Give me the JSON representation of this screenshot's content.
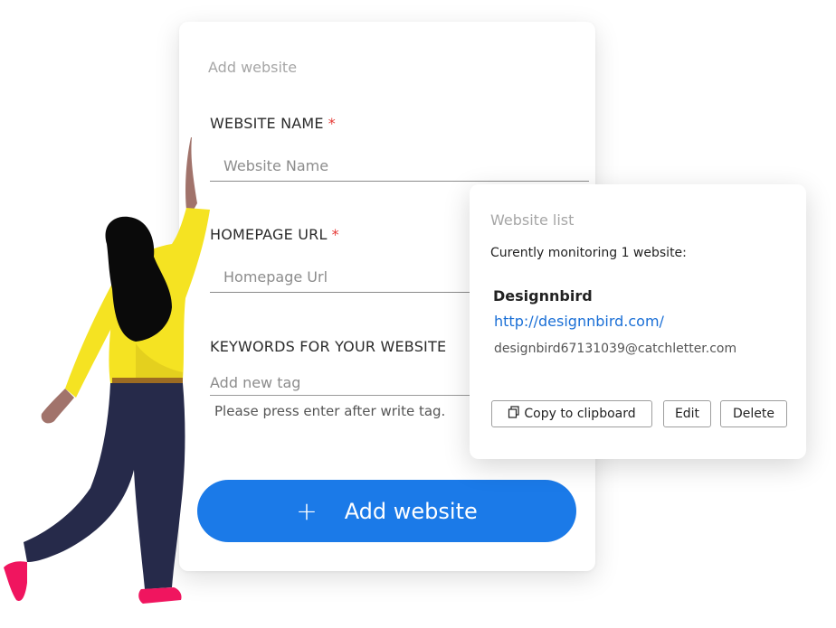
{
  "add_form": {
    "title": "Add website",
    "website_name": {
      "label": "WEBSITE NAME",
      "required_mark": "*",
      "placeholder": "Website Name"
    },
    "homepage_url": {
      "label": "HOMEPAGE URL",
      "required_mark": "*",
      "placeholder": "Homepage Url"
    },
    "keywords": {
      "label": "KEYWORDS FOR YOUR WEBSITE",
      "placeholder": "Add new tag",
      "hint": "Please press enter after write tag."
    },
    "submit": {
      "icon": "plus-icon",
      "label": "Add website"
    }
  },
  "website_list": {
    "title": "Website list",
    "status": "Curently monitoring 1 website:",
    "site": {
      "name": "Designnbird",
      "url": "http://designnbird.com/",
      "email": "designbird67131039@catchletter.com"
    },
    "actions": {
      "copy_icon": "copy-icon",
      "copy_label": "Copy to clipboard",
      "edit_label": "Edit",
      "delete_label": "Delete"
    }
  },
  "colors": {
    "accent": "#1b7ae8",
    "required": "#e53935",
    "link": "#1a6fd6",
    "sweater": "#f5e322",
    "pants": "#262a4a",
    "shoes": "#f0155f"
  }
}
